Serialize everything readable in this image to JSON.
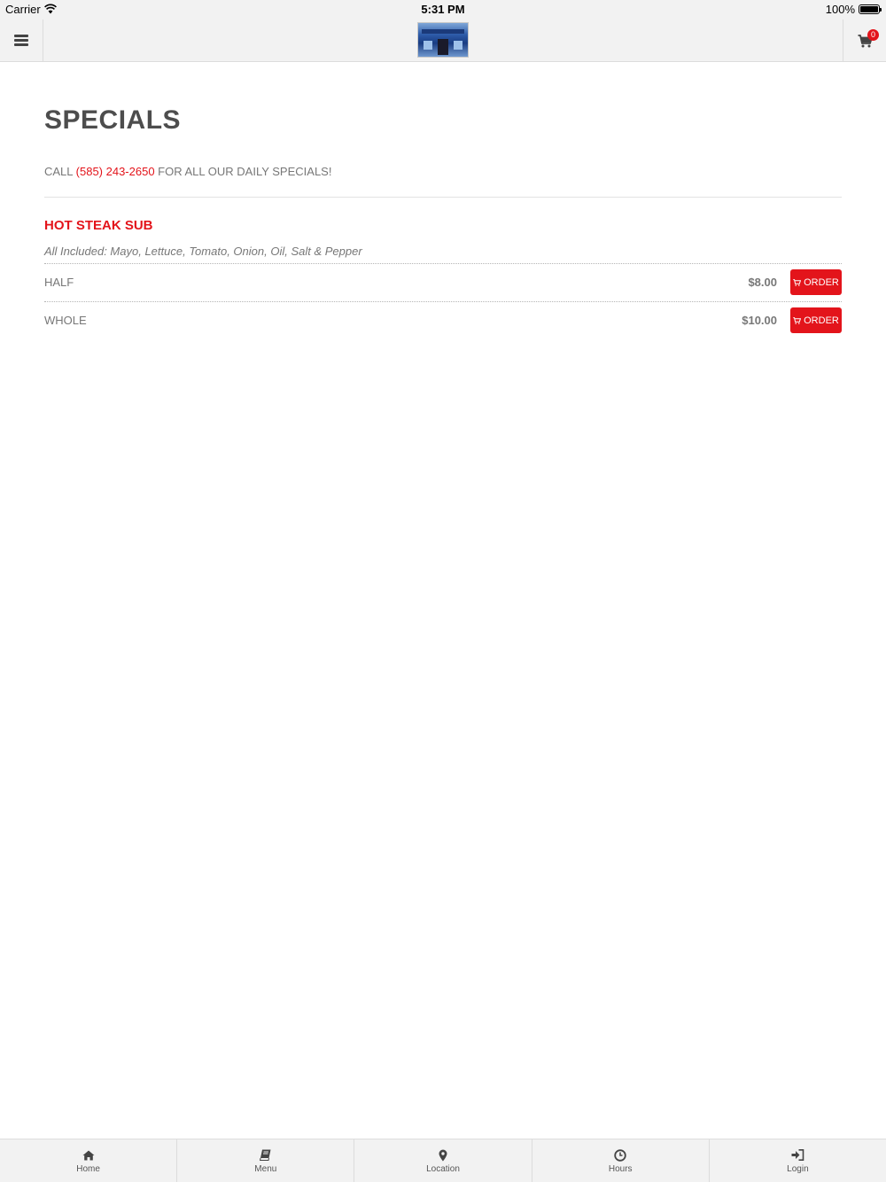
{
  "status_bar": {
    "carrier": "Carrier",
    "time": "5:31 PM",
    "battery": "100%"
  },
  "header": {
    "menu_icon": "hamburger-icon",
    "logo_alt": "restaurant-logo",
    "cart_icon": "shopping-cart-icon",
    "cart_count": "0"
  },
  "page": {
    "title": "SPECIALS",
    "intro_before": "CALL ",
    "phone": "(585) 243-2650",
    "intro_after": " FOR ALL OUR DAILY SPECIALS!"
  },
  "item": {
    "name": "HOT STEAK SUB",
    "description": "All Included: Mayo, Lettuce, Tomato, Onion, Oil, Salt & Pepper",
    "options": [
      {
        "size": "HALF",
        "price": "$8.00",
        "order_label": "ORDER"
      },
      {
        "size": "WHOLE",
        "price": "$10.00",
        "order_label": "ORDER"
      }
    ]
  },
  "colors": {
    "accent": "#e3141b",
    "bar_bg": "#f2f2f2",
    "title": "#4d4d4d"
  },
  "bottom_nav": [
    {
      "label": "Home",
      "icon": "home-icon"
    },
    {
      "label": "Menu",
      "icon": "book-icon"
    },
    {
      "label": "Location",
      "icon": "map-pin-icon"
    },
    {
      "label": "Hours",
      "icon": "clock-icon"
    },
    {
      "label": "Login",
      "icon": "sign-in-icon"
    }
  ]
}
